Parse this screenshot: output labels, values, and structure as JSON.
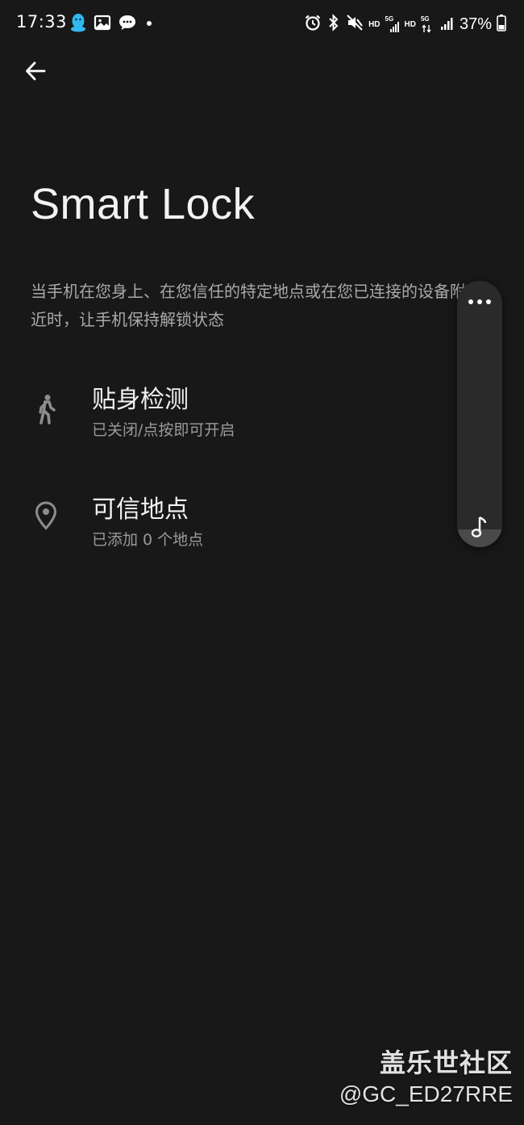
{
  "status_bar": {
    "time": "17:33",
    "hd_label_1": "HD",
    "hd_label_2": "HD",
    "fiveg_label_1": "5G",
    "fiveg_label_2": "5G",
    "battery_percent": "37%",
    "left_icons": [
      "qq-icon",
      "gallery-icon",
      "message-icon",
      "dot-icon"
    ],
    "right_icons": [
      "alarm-icon",
      "bluetooth-icon",
      "mute-icon",
      "signal-icon",
      "battery-icon"
    ]
  },
  "header": {
    "back_icon": "arrow-left-icon"
  },
  "page": {
    "title": "Smart Lock",
    "description": "当手机在您身上、在您信任的特定地点或在您已连接的设备附近时，让手机保持解锁状态"
  },
  "settings": [
    {
      "icon": "walking-person-icon",
      "title": "贴身检测",
      "subtitle": "已关闭/点按即可开启"
    },
    {
      "icon": "location-pin-icon",
      "title": "可信地点",
      "subtitle": "已添加 0 个地点"
    }
  ],
  "floating_panel": {
    "more_icon": "more-horizontal-icon",
    "music_icon": "music-note-icon"
  },
  "watermark": {
    "brand": "盖乐世社区",
    "user": "@GC_ED27RRE"
  },
  "colors": {
    "background": "#181818",
    "title": "#f2f2f2",
    "secondary_text": "#a9a9a9",
    "icon": "#8e8e8e"
  }
}
